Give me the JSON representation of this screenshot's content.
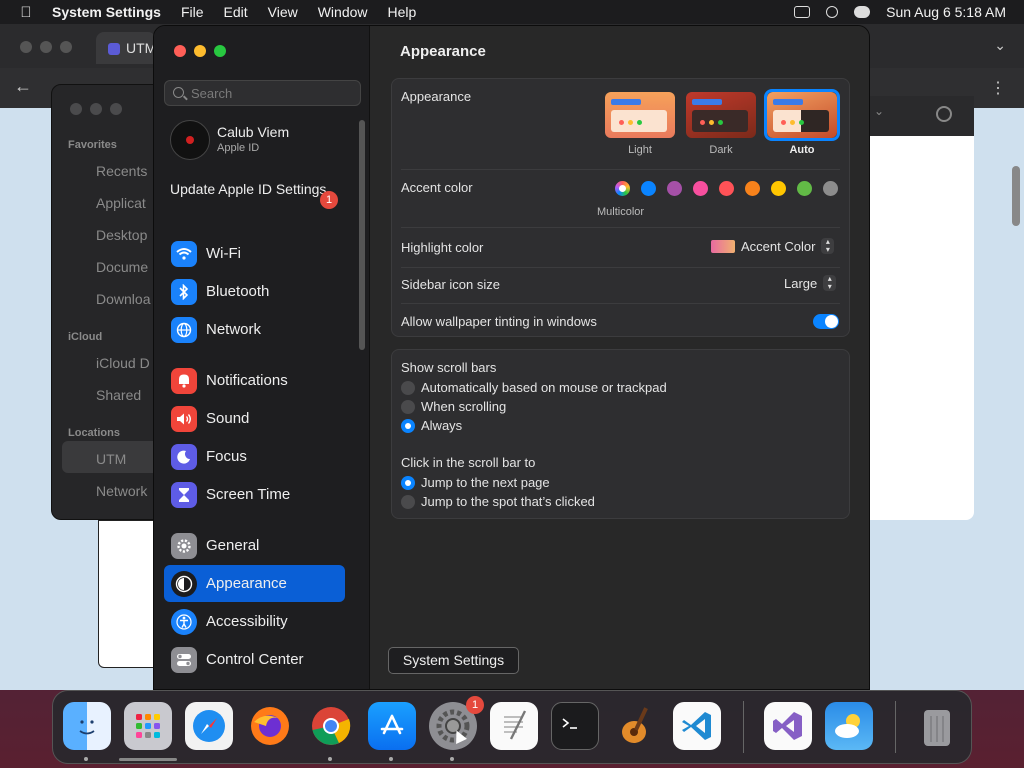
{
  "menubar": {
    "app_name": "System Settings",
    "menus": [
      "File",
      "Edit",
      "View",
      "Window",
      "Help"
    ],
    "datetime": "Sun Aug 6  5:18 AM"
  },
  "browser": {
    "tab_title": "UTM"
  },
  "finder": {
    "favorites_header": "Favorites",
    "favorites": [
      "Recents",
      "Applicat",
      "Desktop",
      "Docume",
      "Downloa"
    ],
    "icloud_header": "iCloud",
    "icloud": [
      "iCloud D",
      "Shared"
    ],
    "locations_header": "Locations",
    "locations": [
      "UTM",
      "Network"
    ]
  },
  "sidebar": {
    "search_placeholder": "Search",
    "user_name": "Calub Viem",
    "user_sub": "Apple ID",
    "update_label": "Update Apple ID Settings",
    "update_badge": "1",
    "items": [
      {
        "label": "Wi-Fi",
        "icon": "wifi-icon",
        "color": "#1a82fb"
      },
      {
        "label": "Bluetooth",
        "icon": "bluetooth-icon",
        "color": "#1a82fb"
      },
      {
        "label": "Network",
        "icon": "globe-icon",
        "color": "#1a82fb"
      },
      {
        "label": "Notifications",
        "icon": "bell-icon",
        "color": "#f0453a"
      },
      {
        "label": "Sound",
        "icon": "speaker-icon",
        "color": "#f0453a"
      },
      {
        "label": "Focus",
        "icon": "moon-icon",
        "color": "#5e5ce6"
      },
      {
        "label": "Screen Time",
        "icon": "hourglass-icon",
        "color": "#5e5ce6"
      },
      {
        "label": "General",
        "icon": "gear-icon",
        "color": "#8e8e93"
      },
      {
        "label": "Appearance",
        "icon": "appearance-icon",
        "color": "#1c1c1e"
      },
      {
        "label": "Accessibility",
        "icon": "accessibility-icon",
        "color": "#1a82fb"
      },
      {
        "label": "Control Center",
        "icon": "control-center-icon",
        "color": "#8e8e93"
      }
    ],
    "active_item": "Appearance"
  },
  "main": {
    "title": "Appearance",
    "appearance": {
      "label": "Appearance",
      "options": [
        "Light",
        "Dark",
        "Auto"
      ],
      "selected": "Auto"
    },
    "accent": {
      "label": "Accent color",
      "multicolor_label": "Multicolor",
      "colors": [
        "#0a84ff",
        "#a550a7",
        "#f74f9e",
        "#ff5257",
        "#f7821b",
        "#ffc600",
        "#62ba46",
        "#8c8c8c"
      ],
      "selected": "Multicolor"
    },
    "highlight": {
      "label": "Highlight color",
      "value": "Accent Color"
    },
    "sidebar_icon_size": {
      "label": "Sidebar icon size",
      "value": "Large"
    },
    "wallpaper_tinting": {
      "label": "Allow wallpaper tinting in windows",
      "on": true
    },
    "scroll_bars": {
      "label": "Show scroll bars",
      "options": [
        "Automatically based on mouse or trackpad",
        "When scrolling",
        "Always"
      ],
      "selected": "Always"
    },
    "click_scroll": {
      "label": "Click in the scroll bar to",
      "options": [
        "Jump to the next page",
        "Jump to the spot that’s clicked"
      ],
      "selected": "Jump to the next page"
    },
    "help_label": "?"
  },
  "tooltip": "System Settings",
  "dock": {
    "apps": [
      "Finder",
      "Launchpad",
      "Safari",
      "Firefox",
      "Chrome",
      "App Store",
      "System Settings",
      "TextEdit",
      "Terminal",
      "GarageBand",
      "Visual Studio Code",
      "Visual Studio",
      "Weather",
      "Trash"
    ],
    "settings_badge": "1"
  }
}
